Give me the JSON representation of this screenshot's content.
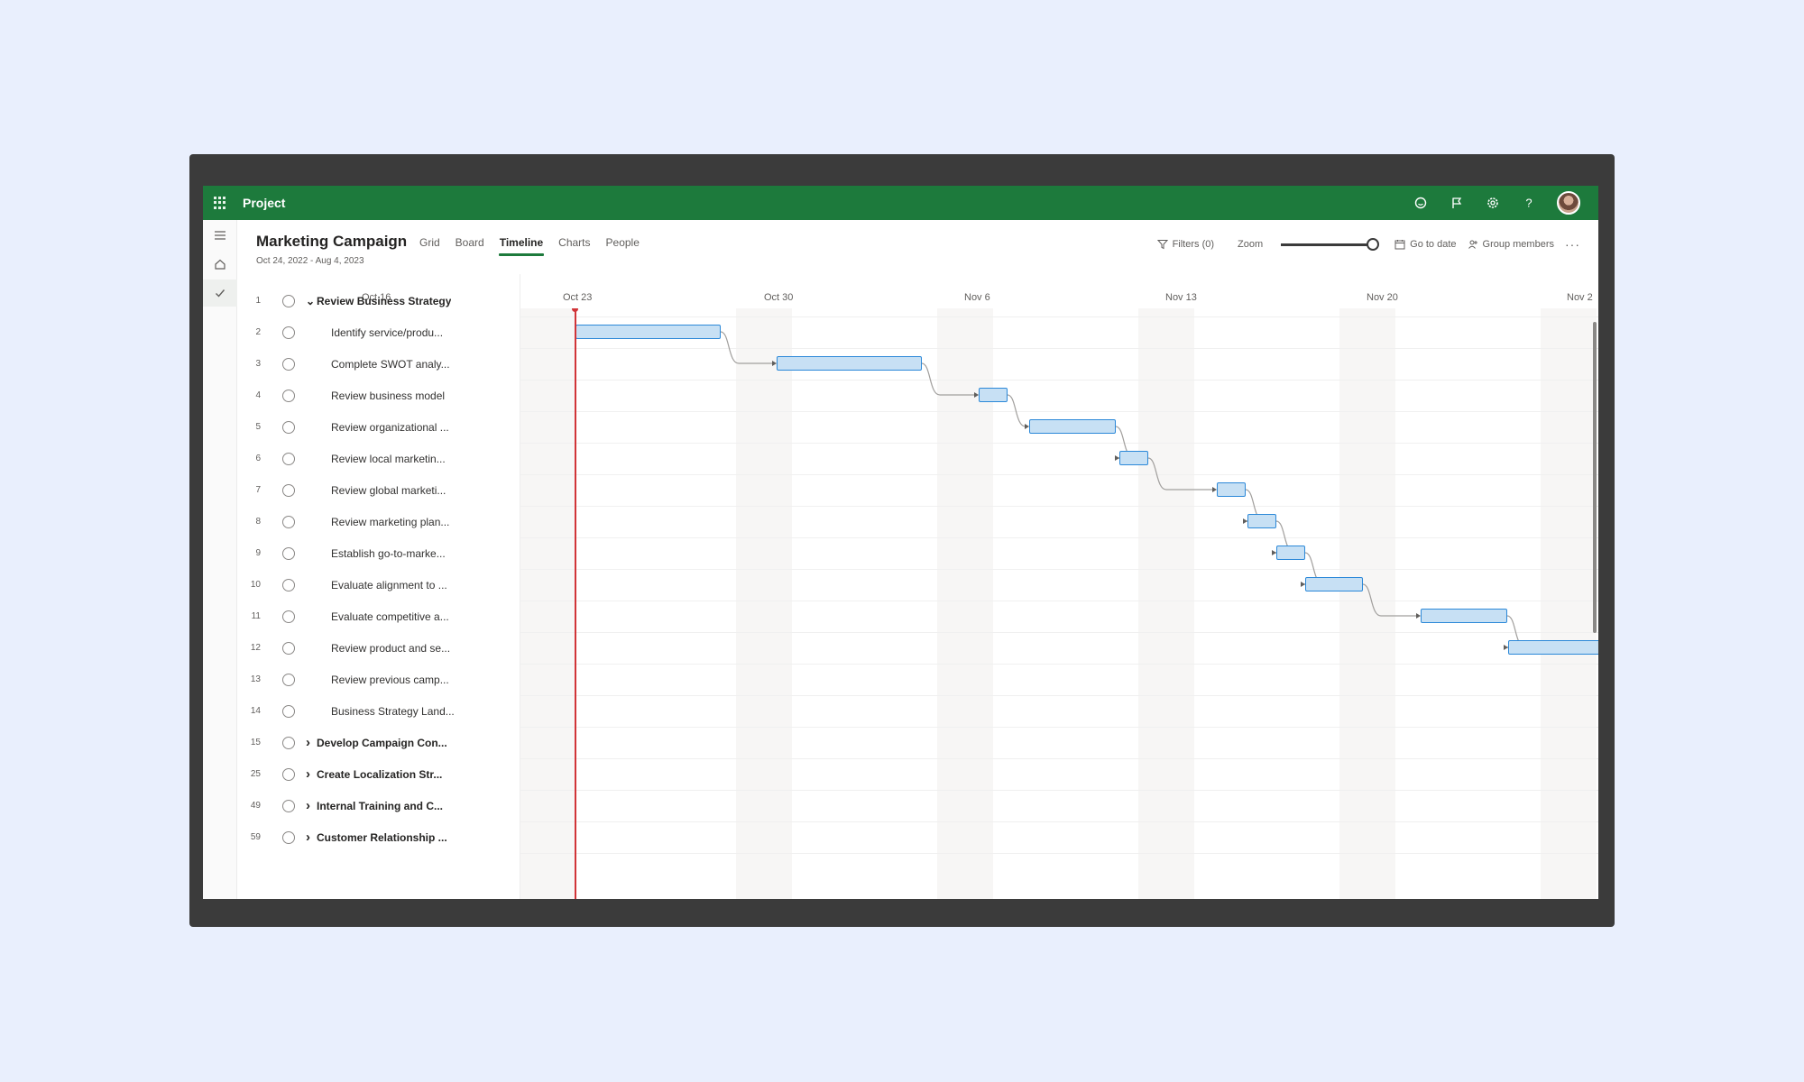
{
  "app": {
    "name": "Project",
    "icons": [
      "waffle-icon",
      "feedback-icon",
      "flag-icon",
      "settings-icon",
      "help-icon",
      "avatar"
    ]
  },
  "project": {
    "title": "Marketing Campaign",
    "dates": "Oct 24, 2022 - Aug 4, 2023"
  },
  "tabs": [
    {
      "label": "Grid"
    },
    {
      "label": "Board"
    },
    {
      "label": "Timeline",
      "active": true
    },
    {
      "label": "Charts"
    },
    {
      "label": "People"
    }
  ],
  "toolbar": {
    "filters": "Filters (0)",
    "zoom": "Zoom",
    "zoom_level": 1.0,
    "go_to_date": "Go to date",
    "group_members": "Group members"
  },
  "timeline": {
    "dates": [
      "Oct 16",
      "Oct 23",
      "Oct 30",
      "Nov 6",
      "Nov 13",
      "Nov 20",
      "Nov 2"
    ]
  },
  "tasks": [
    {
      "num": "1",
      "name": "Review Business Strategy",
      "summary": true,
      "expanded": true
    },
    {
      "num": "2",
      "name": "Identify service/produ..."
    },
    {
      "num": "3",
      "name": "Complete SWOT analy..."
    },
    {
      "num": "4",
      "name": "Review business model"
    },
    {
      "num": "5",
      "name": "Review organizational ..."
    },
    {
      "num": "6",
      "name": "Review local marketin..."
    },
    {
      "num": "7",
      "name": "Review global marketi..."
    },
    {
      "num": "8",
      "name": "Review marketing plan..."
    },
    {
      "num": "9",
      "name": "Establish go-to-marke..."
    },
    {
      "num": "10",
      "name": "Evaluate alignment to ..."
    },
    {
      "num": "11",
      "name": "Evaluate competitive a..."
    },
    {
      "num": "12",
      "name": "Review product and se..."
    },
    {
      "num": "13",
      "name": "Review previous camp..."
    },
    {
      "num": "14",
      "name": "Business Strategy Land..."
    },
    {
      "num": "15",
      "name": "Develop Campaign Con...",
      "summary": true,
      "expanded": false
    },
    {
      "num": "25",
      "name": "Create Localization Str...",
      "summary": true,
      "expanded": false
    },
    {
      "num": "49",
      "name": "Internal Training and C...",
      "summary": true,
      "expanded": false
    },
    {
      "num": "59",
      "name": "Customer Relationship ...",
      "summary": true,
      "expanded": false
    }
  ]
}
